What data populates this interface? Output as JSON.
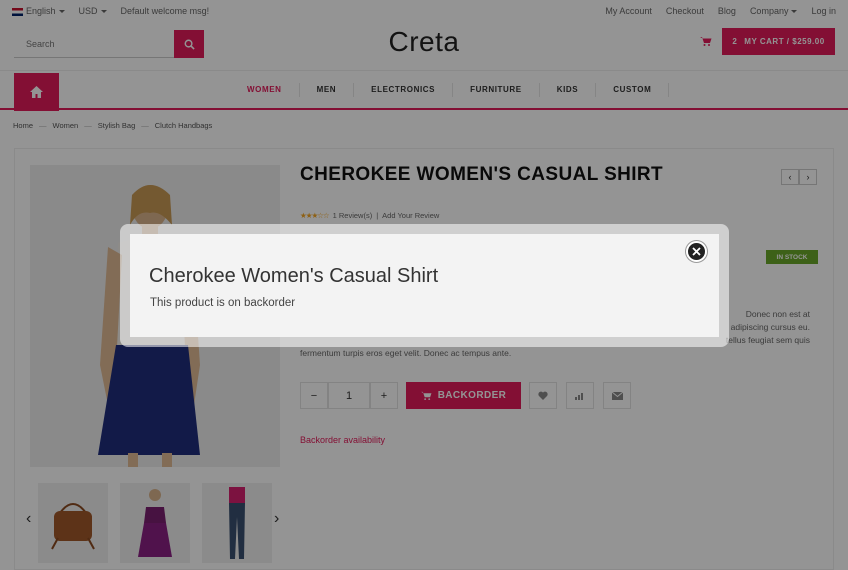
{
  "topbar": {
    "language": "English",
    "currency": "USD",
    "welcome": "Default welcome msg!",
    "links": [
      "My Account",
      "Checkout",
      "Blog",
      "Company",
      "Log in"
    ]
  },
  "header": {
    "search_placeholder": "Search",
    "logo": "Creta",
    "cart_count": "2",
    "cart_label": "MY CART / $259.00"
  },
  "nav": {
    "items": [
      "WOMEN",
      "MEN",
      "ELECTRONICS",
      "FURNITURE",
      "KIDS",
      "CUSTOM"
    ],
    "active": "WOMEN"
  },
  "breadcrumb": [
    "Home",
    "Women",
    "Stylish Bag",
    "Clutch Handbags"
  ],
  "product": {
    "title": "CHEROKEE WOMEN'S CASUAL SHIRT",
    "rating_stars": 3.5,
    "reviews": "1 Review(s)",
    "add_review": "Add Your Review",
    "stock": "IN STOCK",
    "desc_line1": "Donec non est at",
    "desc_line2": "adipiscing cursus eu.",
    "desc_line3": "tellus feugiat sem quis",
    "desc_line4": "fermentum turpis eros eget velit. Donec ac tempus ante.",
    "qty": "1",
    "backorder_label": "BACKORDER",
    "availability": "Backorder availability"
  },
  "modal": {
    "title": "Cherokee Women's Casual Shirt",
    "message": "This product is on backorder"
  },
  "colors": {
    "accent": "#e21b5a",
    "stock": "#6aa82a"
  }
}
